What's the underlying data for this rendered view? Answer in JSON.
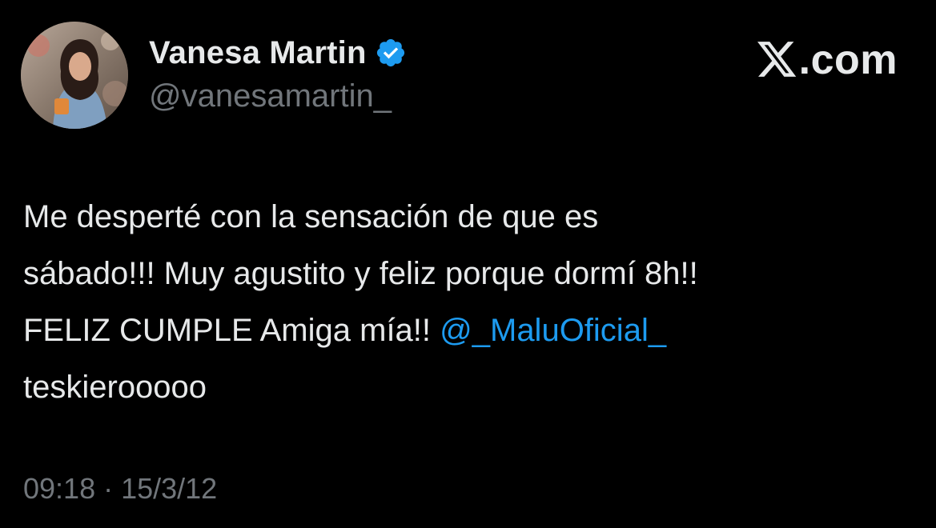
{
  "author": {
    "display_name": "Vanesa Martin",
    "handle": "@vanesamartin_",
    "verified": true,
    "verified_color": "#1d9bf0"
  },
  "brand": {
    "site": ".com",
    "logo_icon": "x-logo-icon"
  },
  "tweet": {
    "line1": "Me desperté con la sensación de que es",
    "line2": "sábado!!! Muy agustito y feliz porque dormí 8h!!",
    "line3_text": "FELIZ CUMPLE Amiga mía!! ",
    "line3_mention": "@_MaluOficial_",
    "line4": "teskierooooo",
    "mention_color": "#1d9bf0"
  },
  "meta": {
    "timestamp": "09:18 · 15/3/12"
  },
  "colors": {
    "background": "#000000",
    "primary_text": "#e7e9ea",
    "secondary_text": "#71767b"
  }
}
